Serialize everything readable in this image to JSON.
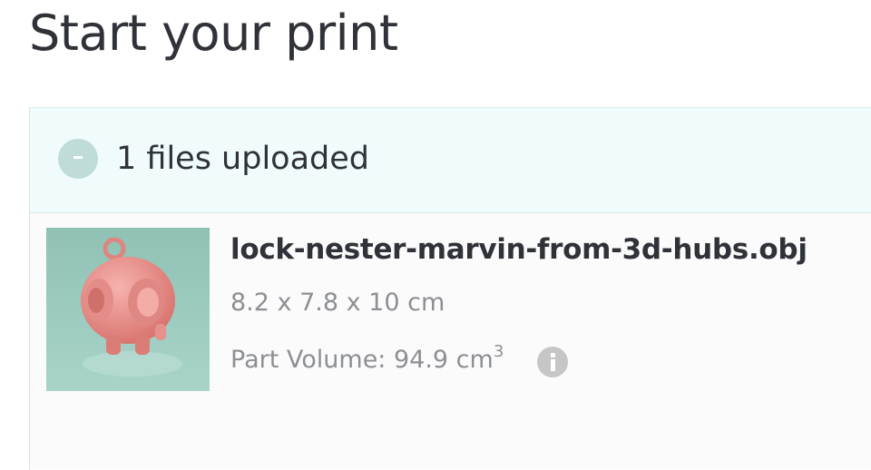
{
  "page": {
    "title": "Start your print"
  },
  "upload_panel": {
    "collapse_icon": "minus-icon",
    "files_count_label": "1 files uploaded",
    "accent_color": "#effcfb",
    "files": [
      {
        "name": "lock-nester-marvin-from-3d-hubs.obj",
        "dimensions": "8.2 x 7.8 x 10 cm",
        "volume_prefix": "Part Volume: 94.9 cm",
        "volume_superscript": "3",
        "info_icon": "info-icon",
        "thumbnail": "model-thumbnail-image"
      }
    ]
  }
}
